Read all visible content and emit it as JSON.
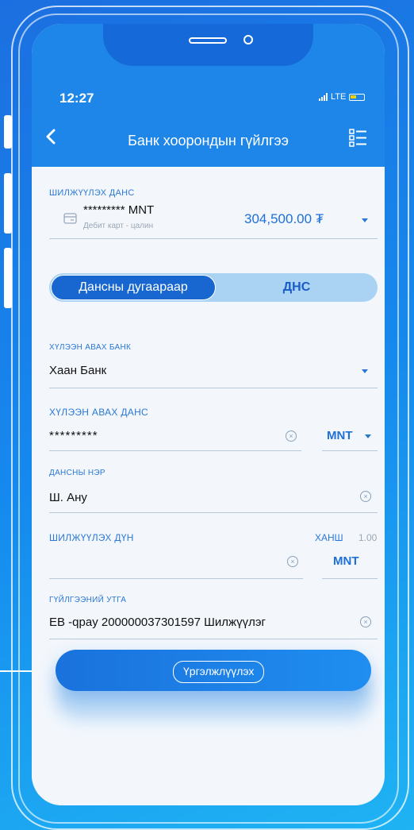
{
  "status_bar": {
    "time": "12:27",
    "network": "LTE"
  },
  "header": {
    "title": "Банк хоорондын гүйлгээ"
  },
  "source_account": {
    "label": "ШИЛЖҮҮЛЭХ ДАНС",
    "account_number": "********* MNT",
    "account_type": "Дебит карт - цалин",
    "balance": "304,500.00 ₮"
  },
  "toggle": {
    "active": "Дансны дугаараар",
    "inactive": "ДНС"
  },
  "receiver_bank": {
    "label": "ХҮЛЭЭН АВАХ БАНК",
    "value": "Хаан Банк"
  },
  "receiver_account": {
    "label": "ХҮЛЭЭН АВАХ ДАНС",
    "value": "*********",
    "currency": "MNT"
  },
  "account_name": {
    "label": "ДАНСНЫ НЭР",
    "value": "Ш. Ану"
  },
  "amount": {
    "label": "ШИЛЖҮҮЛЭХ ДҮН",
    "rate_label": "ХАНШ",
    "rate_value": "1.00",
    "value": "",
    "currency": "MNT"
  },
  "description": {
    "label": "ГҮЙЛГЭЭНИЙ УТГА",
    "value": "EB -qpay 200000037301597 Шилжүүлэг"
  },
  "submit": {
    "label": "Үргэлжлүүлэх"
  },
  "colors": {
    "primary": "#1d86e8",
    "accent": "#2a78d6",
    "background_gradient": [
      "#1c6fe0",
      "#1fb3f3"
    ]
  }
}
